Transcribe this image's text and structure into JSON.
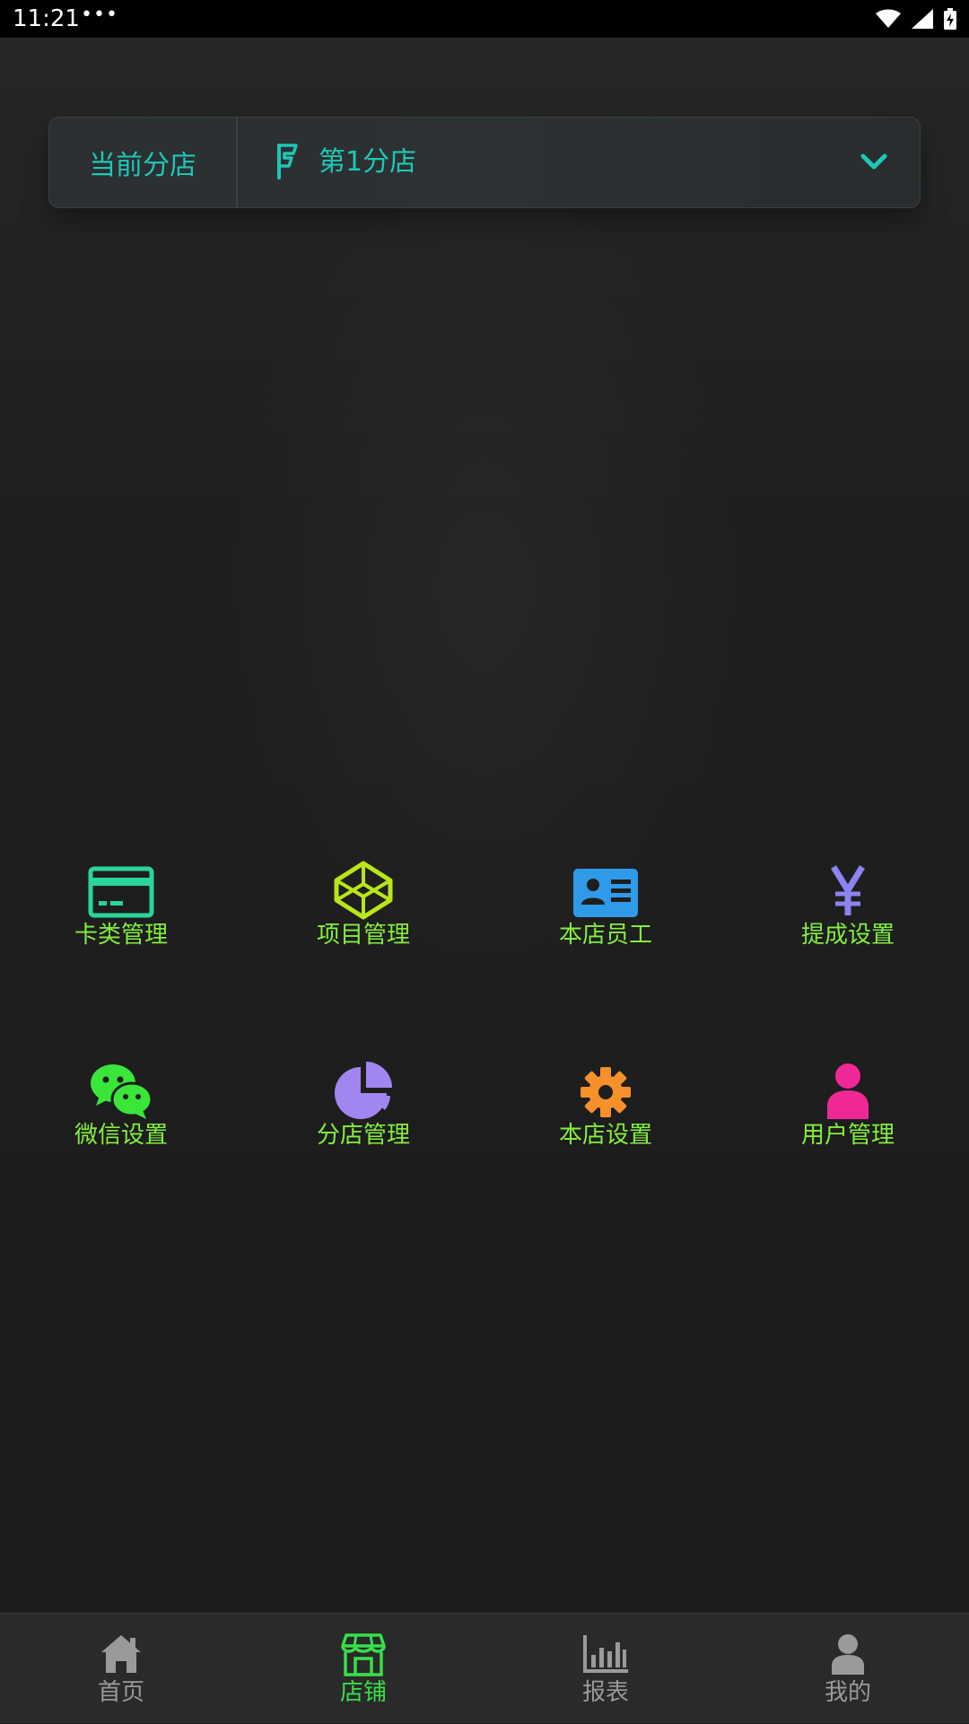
{
  "status_bar": {
    "time": "11:21",
    "notification_dots": "•••",
    "icons": [
      "wifi-icon",
      "cellular-signal-icon",
      "battery-charging-icon"
    ]
  },
  "branch_selector": {
    "label": "当前分店",
    "value": "第1分店",
    "flag_icon": "flag-icon",
    "dropdown_icon": "chevron-down-icon",
    "accent_color": "#1ec7b6"
  },
  "menu": {
    "label_color": "#84ee3e",
    "items": [
      {
        "label": "卡类管理",
        "icon": "credit-card-icon",
        "color": "#2ad59a"
      },
      {
        "label": "项目管理",
        "icon": "codepen-cube-icon",
        "color": "#b8e619"
      },
      {
        "label": "本店员工",
        "icon": "id-card-icon",
        "color": "#2f9be8"
      },
      {
        "label": "提成设置",
        "icon": "yen-icon",
        "color": "#8d83f2"
      },
      {
        "label": "微信设置",
        "icon": "wechat-icon",
        "color": "#39e639"
      },
      {
        "label": "分店管理",
        "icon": "pie-chart-icon",
        "color": "#a286f0"
      },
      {
        "label": "本店设置",
        "icon": "gear-icon",
        "color": "#f5902a"
      },
      {
        "label": "用户管理",
        "icon": "user-icon",
        "color": "#f02896"
      }
    ]
  },
  "tabbar": {
    "active_color": "#38df4a",
    "inactive_color": "#9a9a9a",
    "tabs": [
      {
        "label": "首页",
        "icon": "home-icon",
        "active": false
      },
      {
        "label": "店铺",
        "icon": "store-icon",
        "active": true
      },
      {
        "label": "报表",
        "icon": "bar-chart-icon",
        "active": false
      },
      {
        "label": "我的",
        "icon": "profile-icon",
        "active": false
      }
    ]
  }
}
